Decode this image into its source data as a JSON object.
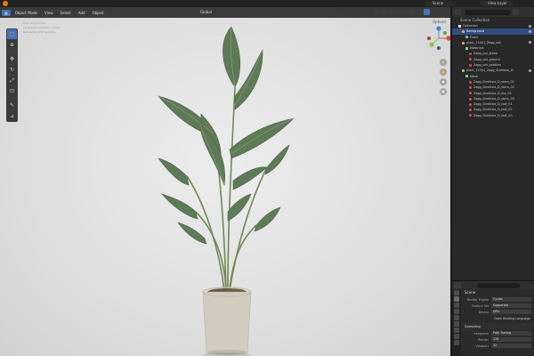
{
  "topbar": {
    "scene_label": "Scene",
    "view_layer_label": "View Layer"
  },
  "viewport": {
    "mode_label": "Object Mode",
    "menus": [
      "View",
      "Select",
      "Add",
      "Object"
    ],
    "transform_orientation": "Global",
    "options_label": "Options",
    "overlay_lines": [
      "User Perspective",
      "(1) Scene Collection | plant",
      "Rendering 1/32 samples"
    ]
  },
  "outliner": {
    "title": "Scene Collection",
    "rows": [
      {
        "label": "Collection",
        "indent": 1,
        "icon": "coll",
        "selected": false
      },
      {
        "label": "Background",
        "indent": 2,
        "icon": "obj",
        "selected": true
      },
      {
        "label": "Plane",
        "indent": 3,
        "icon": "mesh",
        "selected": false
      },
      {
        "label": "plant_11001_Zagg_pot",
        "indent": 2,
        "icon": "obj",
        "selected": false
      },
      {
        "label": "Materials",
        "indent": 3,
        "icon": "vg",
        "selected": false
      },
      {
        "label": "Zagg_pot_stone",
        "indent": 4,
        "icon": "mat",
        "selected": false
      },
      {
        "label": "Zagg_pot_ground",
        "indent": 4,
        "icon": "mat",
        "selected": false
      },
      {
        "label": "Zagg_pot_pebbles",
        "indent": 4,
        "icon": "mat",
        "selected": false
      },
      {
        "label": "plant_11001_Zagg_Strelitzia_D",
        "indent": 2,
        "icon": "obj",
        "selected": false
      },
      {
        "label": "Mesh",
        "indent": 3,
        "icon": "vg",
        "selected": false
      },
      {
        "label": "Zagg_Strelitzia_D_stem_01",
        "indent": 4,
        "icon": "mat",
        "selected": false
      },
      {
        "label": "Zagg_Strelitzia_D_stem_02",
        "indent": 4,
        "icon": "mat",
        "selected": false
      },
      {
        "label": "Zagg_Strelitzia_D_dry_01",
        "indent": 4,
        "icon": "mat",
        "selected": false
      },
      {
        "label": "Zagg_Strelitzia_D_stem_03",
        "indent": 4,
        "icon": "mat",
        "selected": false
      },
      {
        "label": "Zagg_Strelitzia_D_leaf_01",
        "indent": 4,
        "icon": "mat",
        "selected": false
      },
      {
        "label": "Zagg_Strelitzia_D_leaf_02",
        "indent": 4,
        "icon": "mat",
        "selected": false
      },
      {
        "label": "Zagg_Strelitzia_D_leaf_03",
        "indent": 4,
        "icon": "mat",
        "selected": false
      }
    ]
  },
  "properties": {
    "title": "Scene",
    "render_engine_label": "Render Engine",
    "render_engine_value": "Cycles",
    "feature_set_label": "Feature Set",
    "feature_set_value": "Supported",
    "device_label": "Device",
    "device_value": "GPU",
    "osl_label": "Open Shading Language",
    "sampling_label": "Sampling",
    "integrator_label": "Integrator",
    "integrator_value": "Path Tracing",
    "render_label": "Render",
    "render_value": "128",
    "viewport_label": "Viewport",
    "viewport_value": "32"
  },
  "colors": {
    "accent": "#4772b3",
    "selection": "#334d80",
    "leaf": "#5e7a57",
    "pot": "#d2ccc0",
    "viewport_bg": "#e2e2e2"
  }
}
